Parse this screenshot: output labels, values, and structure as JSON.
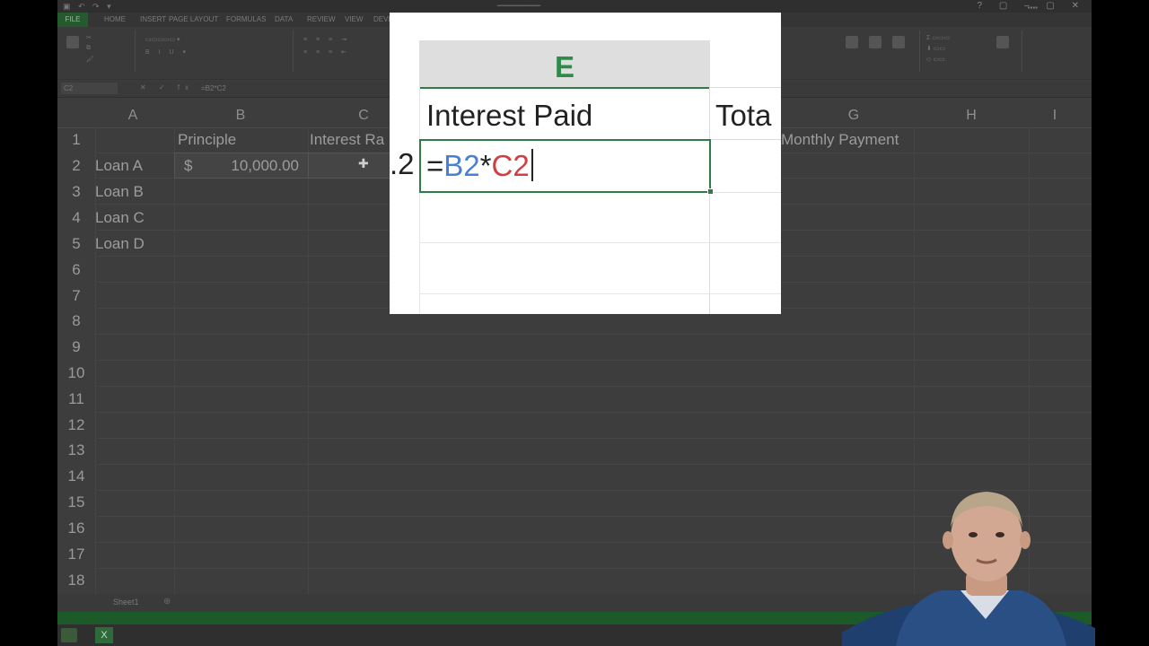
{
  "excel": {
    "ribbon_tabs": [
      "FILE",
      "HOME",
      "INSERT",
      "PAGE LAYOUT",
      "FORMULAS",
      "DATA",
      "REVIEW",
      "VIEW",
      "DEVELOPER"
    ],
    "formula_bar": {
      "name_box": "C2",
      "content": "=B2*C2"
    },
    "column_headers": [
      "A",
      "B",
      "C",
      "G",
      "H",
      "I"
    ],
    "row_numbers": [
      "1",
      "2",
      "3",
      "4",
      "5",
      "6",
      "7",
      "8",
      "9",
      "10",
      "11",
      "12",
      "13",
      "14",
      "15",
      "16",
      "17",
      "18"
    ],
    "header_row": {
      "b": "Principle",
      "c": "Interest Ra",
      "f": "Monthly Payment"
    },
    "loans": [
      "Loan A",
      "Loan B",
      "Loan C",
      "Loan D"
    ],
    "b2": {
      "currency": "$",
      "value": "10,000.00"
    },
    "sheet_tab": "Sheet1",
    "colors": {
      "accent": "#2e7d46",
      "ref_b2": "#4a7fd4",
      "ref_c2": "#d04040"
    }
  },
  "zoom": {
    "column_letter": "E",
    "header": "Interest Paid",
    "next_header_partial": "Tota",
    "prev_cell_partial": ".2",
    "formula": {
      "eq": "=",
      "ref1": "B2",
      "op": "*",
      "ref2": "C2"
    }
  }
}
